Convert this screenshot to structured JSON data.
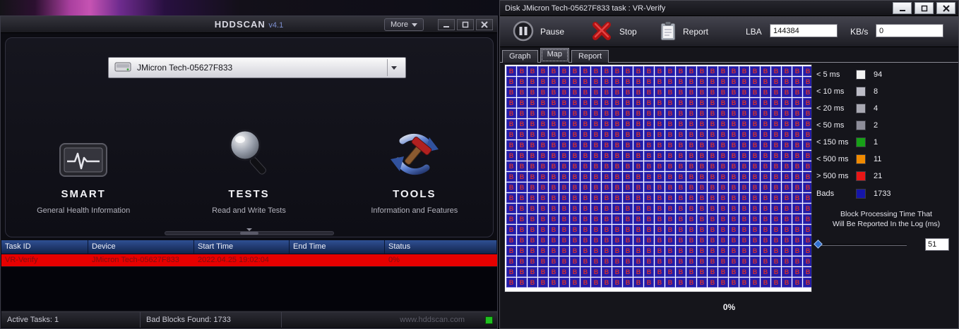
{
  "colors": {
    "task_row_bg": "#e60000",
    "task_row_text": "#7e0f0f",
    "status_led": "#1fc01f"
  },
  "left_window": {
    "title": "HDDSCAN",
    "version": "v4.1",
    "more_button": "More",
    "drive_selector": {
      "value": "JMicron Tech-05627F833"
    },
    "features": [
      {
        "name": "SMART",
        "description": "General Health Information"
      },
      {
        "name": "TESTS",
        "description": "Read and Write Tests"
      },
      {
        "name": "TOOLS",
        "description": "Information and Features"
      }
    ],
    "task_table": {
      "headers": [
        "Task ID",
        "Device",
        "Start Time",
        "End Time",
        "Status"
      ],
      "rows": [
        {
          "task_id": "VR-Verify",
          "device": "JMicron Tech-05627F833",
          "start_time": "2022.04.25 19:02:04",
          "end_time": "",
          "status": "0%"
        }
      ]
    },
    "status_bar": {
      "active_tasks": "Active Tasks: 1",
      "bad_blocks": "Bad Blocks Found: 1733",
      "website": "www.hddscan.com"
    }
  },
  "right_window": {
    "title": "Disk JMicron Tech-05627F833  task : VR-Verify",
    "toolbar": {
      "pause_label": "Pause",
      "stop_label": "Stop",
      "report_label": "Report",
      "lba_label": "LBA",
      "lba_value": "144384",
      "kbs_label": "KB/s",
      "kbs_value": "0"
    },
    "tabs": [
      "Graph",
      "Map",
      "Report"
    ],
    "active_tab": "Map",
    "map": {
      "columns": 29,
      "rows": 21,
      "block_label": "B",
      "block_color": "#221ca6",
      "block_text_color": "#d23030",
      "block_border_color": "#4a44c2"
    },
    "legend": {
      "items": [
        {
          "label": "< 5 ms",
          "color": "#f2f2f2",
          "count": "94"
        },
        {
          "label": "< 10 ms",
          "color": "#bcbcc6",
          "count": "8"
        },
        {
          "label": "< 20 ms",
          "color": "#a8a8b2",
          "count": "4"
        },
        {
          "label": "< 50 ms",
          "color": "#8e8e9a",
          "count": "2"
        },
        {
          "label": "< 150 ms",
          "color": "#17a017",
          "count": "1"
        },
        {
          "label": "< 500 ms",
          "color": "#f08a00",
          "count": "11"
        },
        {
          "label": "> 500 ms",
          "color": "#e81616",
          "count": "21"
        },
        {
          "label": "Bads",
          "color": "#1515a8",
          "count": "1733",
          "gap_before": true
        }
      ],
      "note_line1": "Block Processing Time That",
      "note_line2": "Will Be Reported In the Log (ms)",
      "slider_value": "51"
    },
    "progress": "0%"
  }
}
